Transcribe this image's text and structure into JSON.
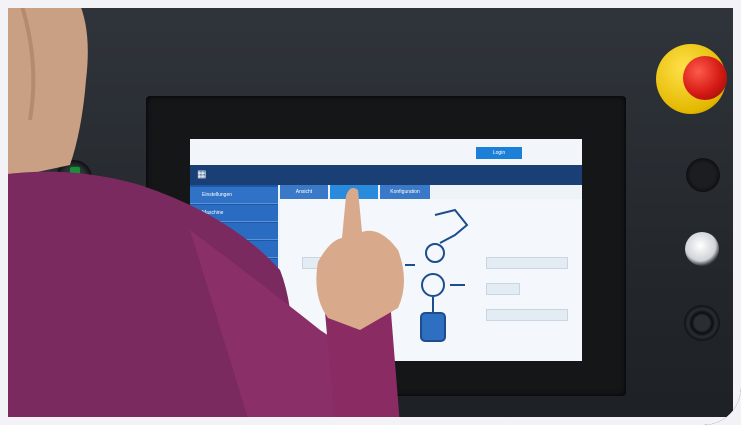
{
  "screen": {
    "header_button": "Login",
    "header_info": "",
    "sidebar": [
      {
        "label": "Einstellungen"
      },
      {
        "label": "Maschine"
      },
      {
        "label": ""
      },
      {
        "label": ""
      },
      {
        "label": ""
      }
    ],
    "tabs": [
      {
        "label": "Ansicht"
      },
      {
        "label": ""
      },
      {
        "label": "Konfiguration"
      }
    ]
  },
  "colors": {
    "nav_bar": "#1a3f74",
    "sidebar": "#1d58a6",
    "accent_button": "#1d80d8",
    "estop_red": "#d41a14",
    "estop_yellow": "#e3b800",
    "sleeve": "#8a2b63"
  },
  "icons": [
    "app-logo-icon",
    "emergency-stop-button",
    "selector-switch",
    "push-button",
    "keyswitch"
  ]
}
